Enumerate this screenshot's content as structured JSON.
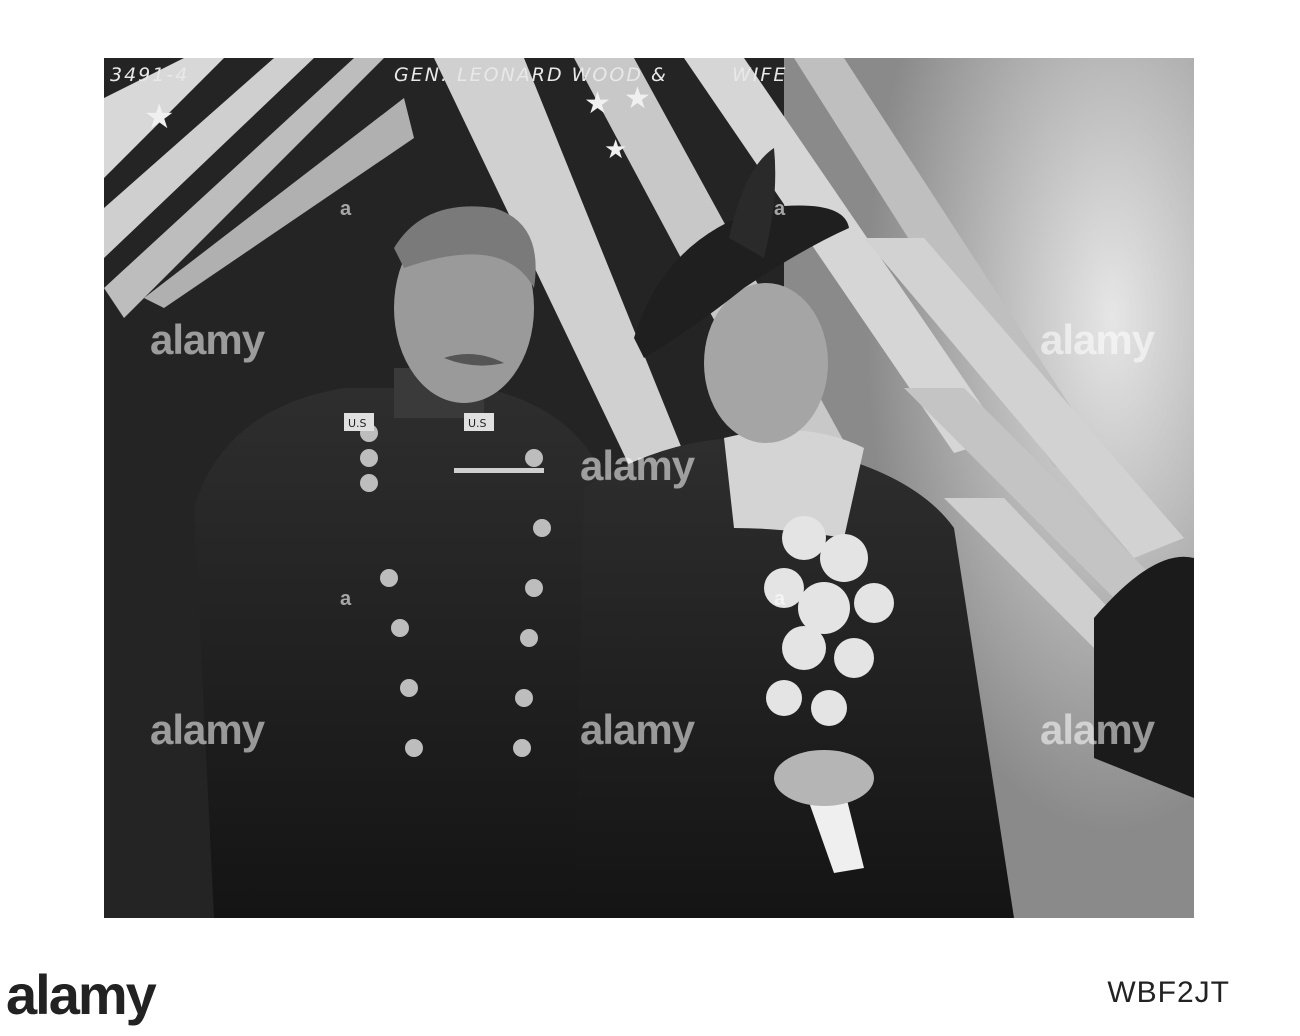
{
  "photo": {
    "caption_number": "3491-4",
    "caption_text": "GEN. LEONARD WOOD &",
    "caption_wife": "WIFE",
    "collar_left": "U.S",
    "collar_right": "U.S"
  },
  "watermark": {
    "text": "alamy",
    "small": "a"
  },
  "footer": {
    "logo": "alamy",
    "image_id": "WBF2JT"
  }
}
